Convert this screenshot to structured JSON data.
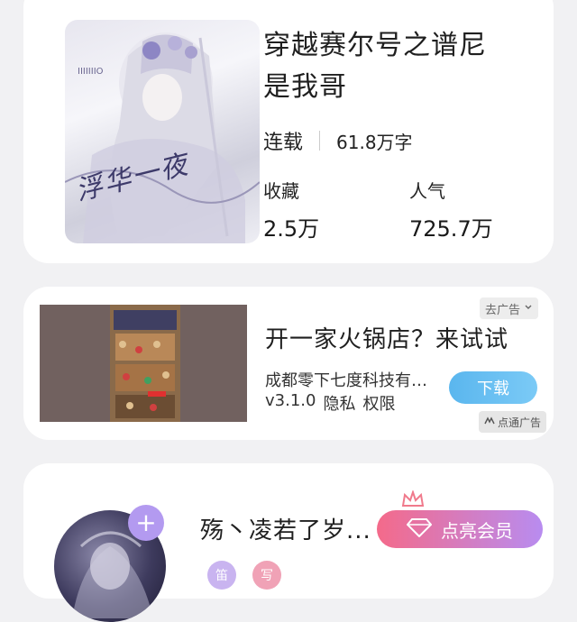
{
  "book": {
    "title_line1": "穿越赛尔号之谱尼",
    "title_line2": "是我哥",
    "status": "连载",
    "word_count": "61.8万字",
    "favorites_label": "收藏",
    "favorites_value": "2.5万",
    "popularity_label": "人气",
    "popularity_value": "725.7万",
    "cover_text": "浮华一夜"
  },
  "ad": {
    "remove_ad_label": "去广告",
    "title": "开一家火锅店？来试试",
    "company": "成都零下七度科技有限公司",
    "version": "v3.1.0",
    "privacy_label": "隐私",
    "permission_label": "权限",
    "download_label": "下载",
    "badge_label": "点通广告"
  },
  "author": {
    "name": "殇丶凌若了岁...",
    "vip_label": "点亮会员",
    "tag1": "笛",
    "tag2": "写"
  },
  "colors": {
    "accent_download": "#5ab6ee",
    "vip_gradient_start": "#f46a8a",
    "vip_gradient_end": "#b88cf0",
    "add_button": "#b39af0"
  }
}
